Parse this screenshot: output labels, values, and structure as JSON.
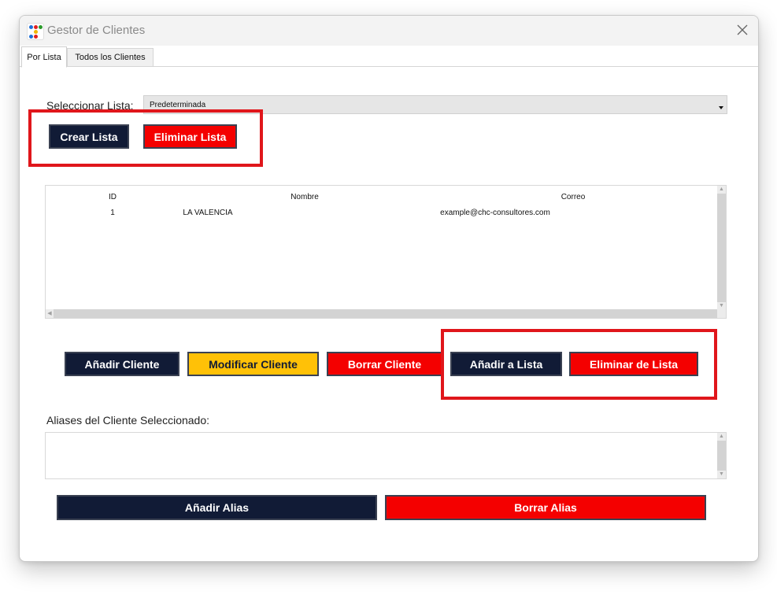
{
  "window": {
    "title": "Gestor de Clientes",
    "icon": "app-dots-icon",
    "close_icon": "close-icon"
  },
  "tabs": [
    {
      "label": "Por Lista",
      "active": true
    },
    {
      "label": "Todos los Clientes",
      "active": false
    }
  ],
  "list_selector": {
    "label": "Seleccionar Lista:",
    "selected": "Predeterminada"
  },
  "list_actions": {
    "create": "Crear Lista",
    "delete": "Eliminar Lista"
  },
  "table": {
    "columns": [
      "ID",
      "Nombre",
      "Correo"
    ],
    "rows": [
      {
        "id": "1",
        "nombre": "LA VALENCIA",
        "correo": "example@chc-consultores.com"
      }
    ]
  },
  "client_actions": {
    "add": "Añadir Cliente",
    "modify": "Modificar Cliente",
    "delete": "Borrar Cliente",
    "add_to_list": "Añadir a Lista",
    "remove_from_list": "Eliminar de Lista"
  },
  "aliases": {
    "label": "Aliases del Cliente Seleccionado:",
    "add": "Añadir Alias",
    "delete": "Borrar Alias"
  },
  "colors": {
    "navy": "#111b36",
    "red": "#f40000",
    "yellow": "#ffc107",
    "highlight": "#e0161b"
  }
}
